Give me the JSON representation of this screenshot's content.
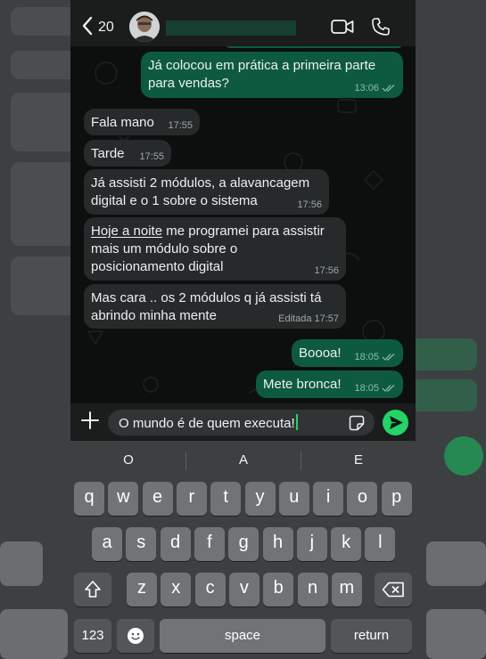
{
  "header": {
    "back_count": "20"
  },
  "messages": [
    {
      "text": "Já colocou em prática a primeira parte para vendas?",
      "time": "13:06",
      "dir": "out"
    },
    {
      "text": "Fala mano",
      "time": "17:55",
      "dir": "in"
    },
    {
      "text": "Tarde",
      "time": "17:55",
      "dir": "in"
    },
    {
      "text": "Já assisti 2 módulos, a alavancagem digital e o 1 sobre o sistema",
      "time": "17:56",
      "dir": "in"
    },
    {
      "text": "Hoje a noite me programei para assistir mais um módulo sobre o posicionamento digital",
      "time": "17:56",
      "dir": "in",
      "link_prefix": "Hoje a noite"
    },
    {
      "text": "Mas cara .. os 2 módulos q já assisti tá abrindo minha mente",
      "time": "17:57",
      "edited": "Editada",
      "dir": "in"
    },
    {
      "text": "Boooa!",
      "time": "18:05",
      "dir": "out"
    },
    {
      "text": "Mete bronca!",
      "time": "18:05",
      "dir": "out"
    }
  ],
  "composer": {
    "text": "O mundo é de quem executa!"
  },
  "keyboard": {
    "suggestions": [
      "O",
      "A",
      "E"
    ],
    "row1": [
      "q",
      "w",
      "e",
      "r",
      "t",
      "y",
      "u",
      "i",
      "o",
      "p"
    ],
    "row2": [
      "a",
      "s",
      "d",
      "f",
      "g",
      "h",
      "j",
      "k",
      "l"
    ],
    "row3": [
      "z",
      "x",
      "c",
      "v",
      "b",
      "n",
      "m"
    ],
    "numbers_label": "123",
    "space_label": "space",
    "return_label": "return"
  },
  "colors": {
    "accent": "#25d366",
    "outgoing_bubble": "#0d5a41",
    "incoming_bubble": "#262a2b"
  },
  "icons": [
    "chevron-left-icon",
    "video-icon",
    "phone-icon",
    "plus-icon",
    "sticker-icon",
    "send-icon",
    "shift-icon",
    "backspace-icon",
    "emoji-icon",
    "double-check-icon"
  ]
}
